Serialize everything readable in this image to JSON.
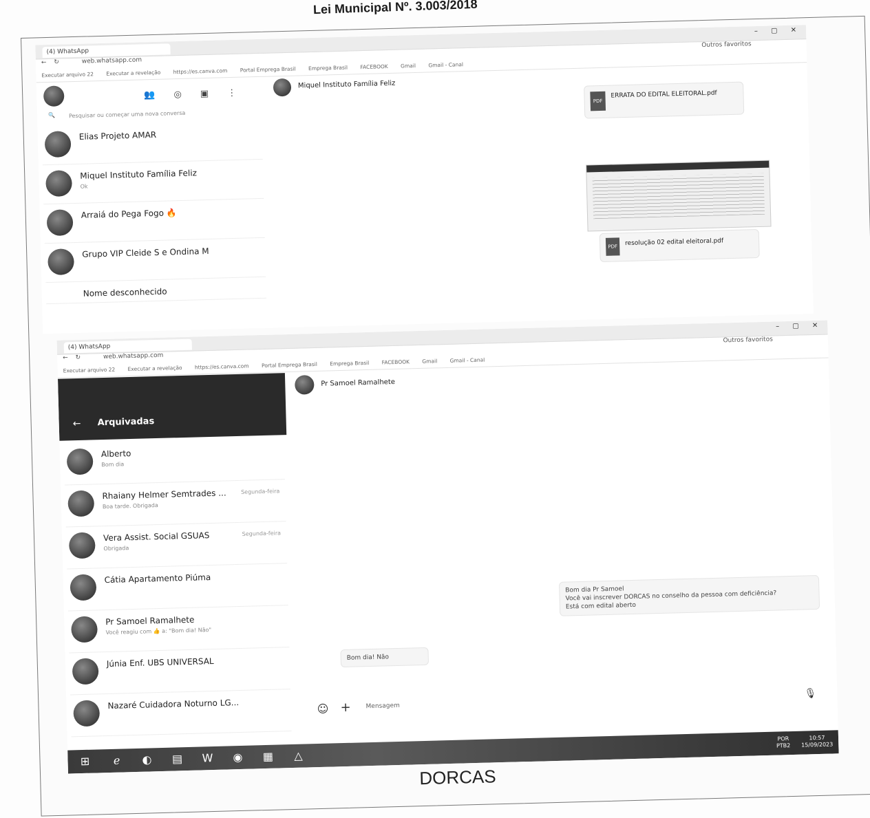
{
  "document": {
    "header": "Lei Municipal Nº. 3.003/2018",
    "caption": "DORCAS"
  },
  "top_screenshot": {
    "browser_tab": "(4) WhatsApp",
    "address": "web.whatsapp.com",
    "other_favorites": "Outros favoritos",
    "bookmarks": [
      "Executar arquivo 22",
      "Executar a revelação",
      "https://es.canva.com",
      "Portal Emprega Brasil",
      "Emprega Brasil",
      "FACEBOOK",
      "Gmail",
      "Gmail - Canal"
    ],
    "current_chat_header": "Miquel Instituto Família Feliz",
    "search_placeholder": "Pesquisar ou começar uma nova conversa",
    "chats": [
      {
        "name": "Elias Projeto AMAR",
        "preview": "",
        "date": ""
      },
      {
        "name": "Miquel Instituto Família Feliz",
        "preview": "Ok",
        "date": ""
      },
      {
        "name": "Arraiá do Pega Fogo 🔥",
        "preview": "",
        "date": ""
      },
      {
        "name": "Grupo VIP Cleide S e Ondina M",
        "preview": "",
        "date": ""
      },
      {
        "name": "Nome desconhecido",
        "preview": "",
        "date": ""
      }
    ],
    "attachments": [
      {
        "name": "ERRATA DO EDITAL ELEITORAL.pdf",
        "type": "PDF"
      },
      {
        "name": "resolução 02 edital eleitoral.pdf",
        "type": "PDF"
      }
    ]
  },
  "bottom_screenshot": {
    "browser_tab": "(4) WhatsApp",
    "address": "web.whatsapp.com",
    "other_favorites": "Outros favoritos",
    "bookmarks": [
      "Executar arquivo 22",
      "Executar a revelação",
      "https://es.canva.com",
      "Portal Emprega Brasil",
      "Emprega Brasil",
      "FACEBOOK",
      "Gmail",
      "Gmail - Canal"
    ],
    "archived_title": "Arquivadas",
    "current_chat_header": "Pr Samoel Ramalhete",
    "chats": [
      {
        "name": "Alberto",
        "preview": "Bom dia",
        "date": ""
      },
      {
        "name": "Rhaiany Helmer Semtrades ...",
        "preview": "Boa tarde. Obrigada",
        "date": "Segunda-feira"
      },
      {
        "name": "Vera Assist. Social GSUAS",
        "preview": "Obrigada",
        "date": "Segunda-feira"
      },
      {
        "name": "Cátia Apartamento Piúma",
        "preview": "",
        "date": ""
      },
      {
        "name": "Pr Samoel Ramalhete",
        "preview": "Você reagiu com 👍 a: \"Bom dia! Não\"",
        "date": ""
      },
      {
        "name": "Júnia Enf. UBS UNIVERSAL",
        "preview": "",
        "date": ""
      },
      {
        "name": "Nazaré Cuidadora Noturno LG...",
        "preview": "",
        "date": ""
      }
    ],
    "outgoing_message_lines": [
      "Bom dia Pr Samoel",
      "Você vai inscrever DORCAS no conselho da pessoa com deficiência?",
      "Está com edital aberto"
    ],
    "incoming_message": "Bom dia! Não",
    "message_placeholder": "Mensagem",
    "taskbar": {
      "language": "POR",
      "layout": "PTB2",
      "time": "10:57",
      "date": "15/09/2023"
    }
  }
}
